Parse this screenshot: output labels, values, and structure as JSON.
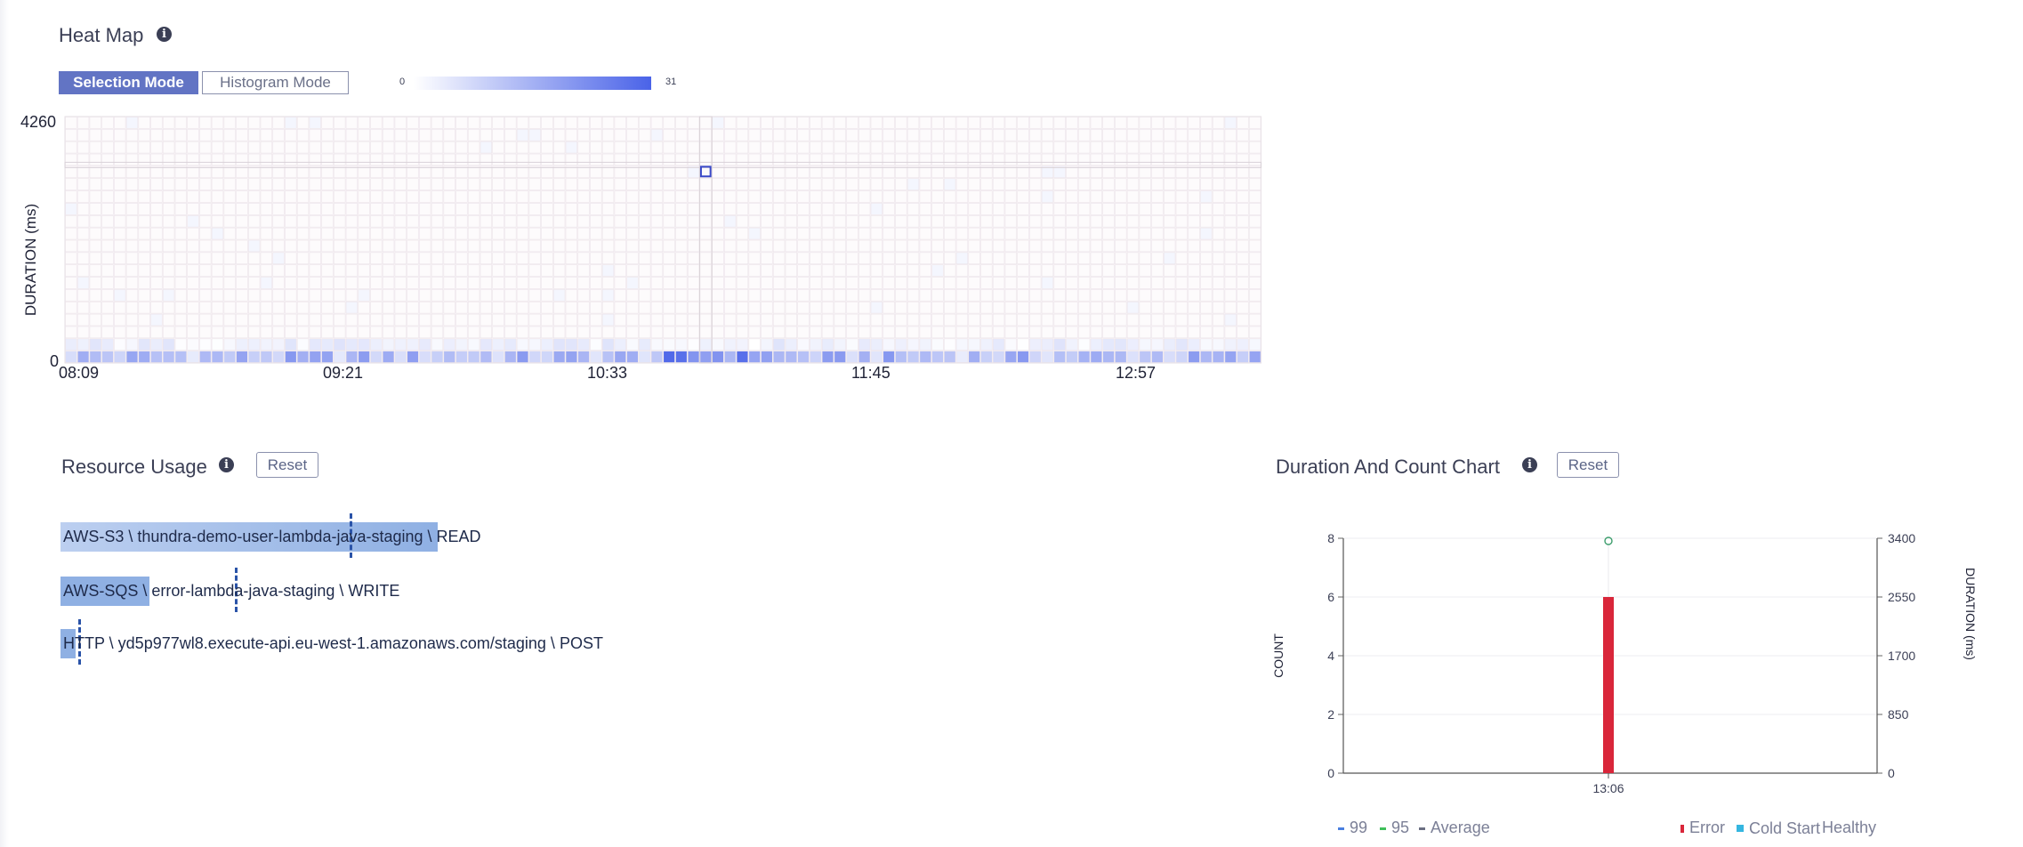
{
  "heatmap": {
    "title": "Heat Map",
    "modes": {
      "selection": "Selection Mode",
      "histogram": "Histogram Mode",
      "active": "selection"
    },
    "scale": {
      "min": "0",
      "max": "31",
      "color_low": "#ffffff",
      "color_high": "#4a63e8"
    },
    "y_axis": {
      "label": "DURATION (ms)",
      "max": "4260",
      "min": "0"
    },
    "x_ticks": [
      "08:09",
      "09:21",
      "10:33",
      "11:45",
      "12:57"
    ],
    "selected_column": 52
  },
  "resource_usage": {
    "title": "Resource Usage",
    "reset_label": "Reset",
    "items": [
      {
        "label": "AWS-S3 \\ thundra-demo-user-lambda-java-staging \\ READ",
        "usage": 1.0,
        "marker": 0.77
      },
      {
        "label": "AWS-SQS \\ error-lambda-java-staging \\ WRITE",
        "usage": 0.235,
        "marker": 0.465
      },
      {
        "label": "HTTP \\ yd5p977wl8.execute-api.eu-west-1.amazonaws.com/staging \\ POST",
        "usage": 0.04,
        "marker": 0.05
      }
    ]
  },
  "duration_chart": {
    "title": "Duration And Count Chart",
    "reset_label": "Reset"
  },
  "chart_data": {
    "type": "bar",
    "categories": [
      "13:06"
    ],
    "series": [
      {
        "name": "Error",
        "values": [
          6
        ],
        "axis": "COUNT"
      }
    ],
    "y_left": {
      "label": "COUNT",
      "ticks": [
        "0",
        "2",
        "4",
        "6",
        "8"
      ],
      "lim": [
        0,
        8
      ]
    },
    "y_right": {
      "label": "DURATION (ms)",
      "ticks": [
        "0",
        "850",
        "1700",
        "2550",
        "3400"
      ],
      "lim": [
        0,
        3400
      ]
    },
    "legend": [
      {
        "name": "99",
        "color": "#4a7fe0"
      },
      {
        "name": "95",
        "color": "#3fbf5a"
      },
      {
        "name": "Average",
        "color": "#6b6f82"
      },
      {
        "name": "Error",
        "color": "#d9263a"
      },
      {
        "name": "Cold Start",
        "color": "#35b6e0"
      },
      {
        "name": "Healthy",
        "color": ""
      }
    ],
    "grid": true,
    "legend_position": "bottom"
  }
}
